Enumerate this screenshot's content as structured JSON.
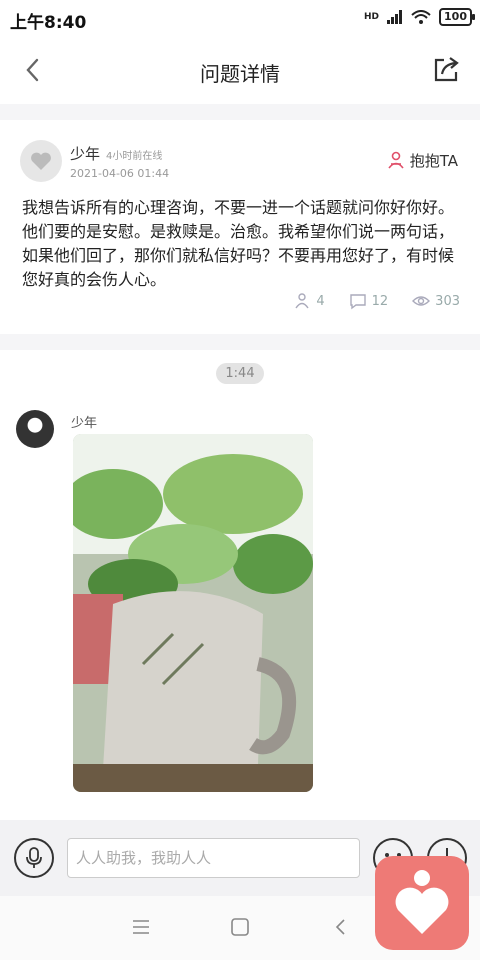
{
  "status": {
    "time": "上午8:40",
    "battery": "100",
    "network": "HD"
  },
  "header": {
    "title": "问题详情"
  },
  "post": {
    "username": "少年",
    "online_status": "4小时前在线",
    "date": "2021-04-06 01:44",
    "hug_label": "抱抱TA",
    "content": "我想告诉所有的心理咨询，不要一进一个话题就问你好你好。他们要的是安慰。是救赎是。治愈。我希望你们说一两句话，如果他们回了，那你们就私信好吗？不要再用您好了，有时候您好真的会伤人心。",
    "hugs": "4",
    "comments": "12",
    "views": "303"
  },
  "chat": {
    "time_divider": "1:44",
    "sender": "少年"
  },
  "input": {
    "placeholder": "人人助我，我助人人"
  },
  "colors": {
    "accent": "#e0506a",
    "app_badge": "#ee7a76"
  }
}
